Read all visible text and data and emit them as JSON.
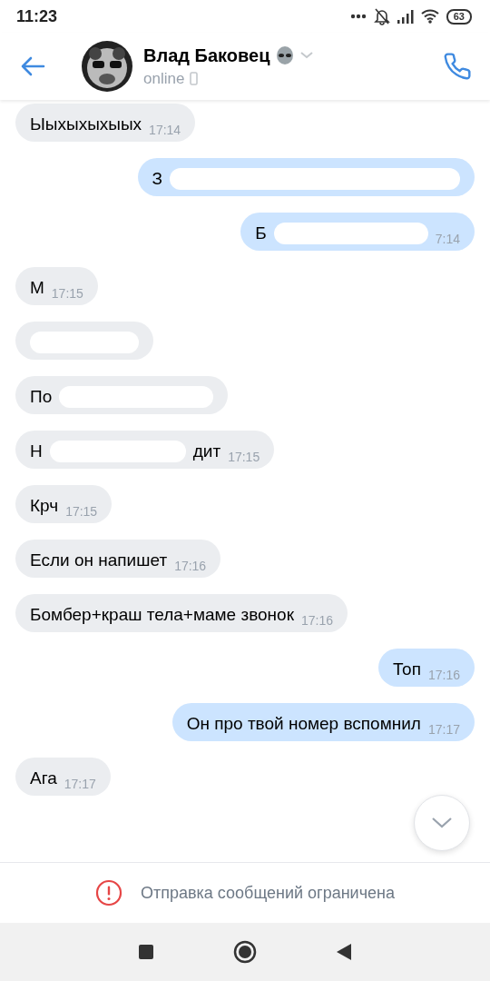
{
  "status_bar": {
    "time": "11:23",
    "battery": "63"
  },
  "header": {
    "name": "Влад Баковец",
    "status": "online"
  },
  "messages": [
    {
      "kind": "incoming",
      "parts": [
        "Ыыхыхыхыых"
      ],
      "time": "17:14",
      "redacted": false
    },
    {
      "kind": "outgoing",
      "parts": [
        "З"
      ],
      "redacted": true
    },
    {
      "kind": "outgoing",
      "parts": [
        "Б"
      ],
      "time": "7:14",
      "redacted": true
    },
    {
      "kind": "incoming",
      "parts": [
        "М"
      ],
      "time": "17:15",
      "redacted": false
    },
    {
      "kind": "incoming",
      "redacted": true
    },
    {
      "kind": "incoming",
      "parts": [
        "По"
      ],
      "redacted": true
    },
    {
      "kind": "incoming",
      "parts": [
        "Н",
        "дит"
      ],
      "time": "17:15",
      "redacted": true
    },
    {
      "kind": "incoming",
      "parts": [
        "Крч"
      ],
      "time": "17:15",
      "redacted": false
    },
    {
      "kind": "incoming",
      "parts": [
        "Если он напишет"
      ],
      "time": "17:16",
      "redacted": false
    },
    {
      "kind": "incoming",
      "parts": [
        "Бомбер+краш тела+маме звонок"
      ],
      "time": "17:16",
      "redacted": false
    },
    {
      "kind": "outgoing",
      "parts": [
        "Топ"
      ],
      "time": "17:16",
      "redacted": false
    },
    {
      "kind": "outgoing",
      "parts": [
        "Он про твой номер вспомнил"
      ],
      "time": "17:17",
      "redacted": false
    },
    {
      "kind": "incoming",
      "parts": [
        "Ага"
      ],
      "time": "17:17",
      "redacted": false
    }
  ],
  "notice": "Отправка сообщений ограничена"
}
